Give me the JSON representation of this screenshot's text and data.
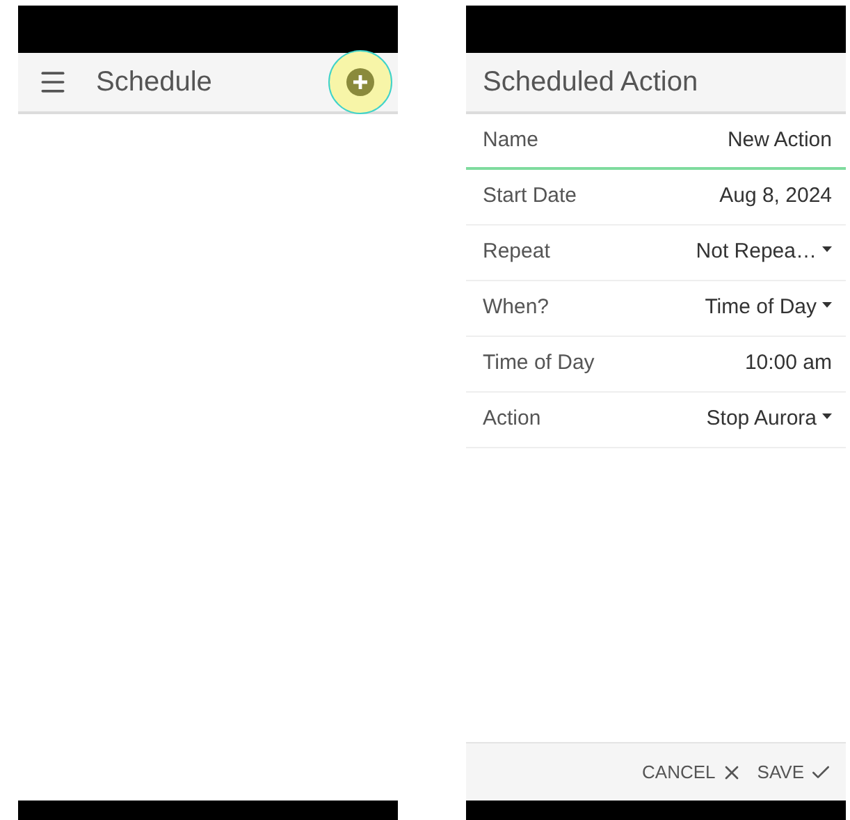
{
  "left_screen": {
    "title": "Schedule",
    "add_button": {
      "highlighted": true
    }
  },
  "right_screen": {
    "title": "Scheduled Action",
    "fields": [
      {
        "label": "Name",
        "value": "New Action",
        "kind": "text",
        "focused": true
      },
      {
        "label": "Start Date",
        "value": "Aug 8, 2024",
        "kind": "text",
        "focused": false
      },
      {
        "label": "Repeat",
        "value": "Not Repea…",
        "kind": "dropdown",
        "focused": false
      },
      {
        "label": "When?",
        "value": "Time of Day",
        "kind": "dropdown",
        "focused": false
      },
      {
        "label": "Time of Day",
        "value": "10:00 am",
        "kind": "text",
        "focused": false
      },
      {
        "label": "Action",
        "value": "Stop Aurora",
        "kind": "dropdown",
        "focused": false
      }
    ],
    "buttons": [
      {
        "label": "CANCEL",
        "kind": "cancel"
      },
      {
        "label": "SAVE",
        "kind": "save"
      }
    ]
  }
}
